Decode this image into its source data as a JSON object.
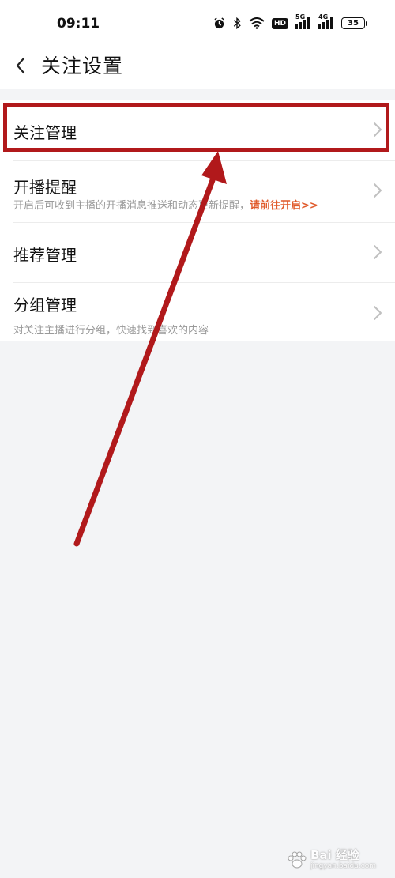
{
  "status_bar": {
    "time": "09:11",
    "network_5g": "5G",
    "network_4g": "4G",
    "hd": "HD",
    "battery": "35"
  },
  "header": {
    "title": "关注设置"
  },
  "settings": {
    "items": [
      {
        "title": "关注管理"
      },
      {
        "title": "开播提醒",
        "subtitle": "开启后可收到主播的开播消息推送和动态更新提醒，",
        "link": "请前往开启>>"
      },
      {
        "title": "推荐管理"
      },
      {
        "title": "分组管理",
        "subtitle": "对关注主播进行分组，快速找到喜欢的内容"
      }
    ]
  },
  "colors": {
    "background": "#f3f4f6",
    "accent_link": "#e05a2b",
    "annotation_red": "#b1191b"
  },
  "watermark": {
    "text": "Bai 经验",
    "url": "jingyan.baidu.com"
  }
}
